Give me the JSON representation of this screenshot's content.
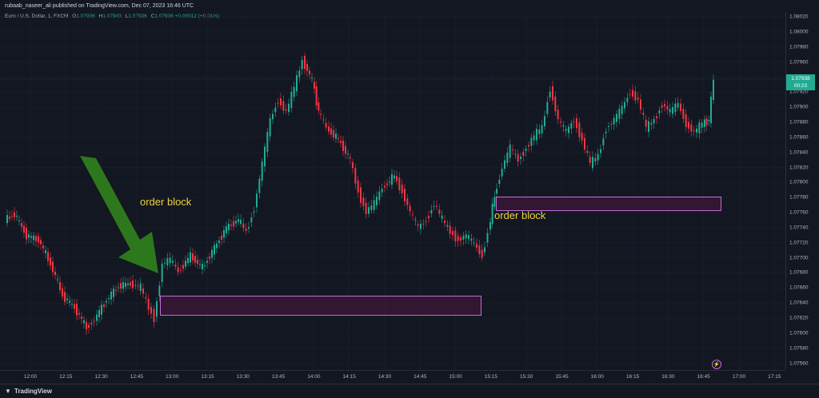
{
  "header": {
    "publisher_text": "rubaab_naseer_ali published on TradingView.com, Dec 07, 2023 16:46 UTC"
  },
  "symbol": {
    "name": "Euro / U.S. Dollar, 1, FXCM",
    "o_label": "O",
    "o_value": "1.07936",
    "h_label": "H",
    "h_value": "1.07943",
    "l_label": "L",
    "l_value": "1.07926",
    "c_label": "C",
    "c_value": "1.07938",
    "change": "+0.00012 (+0.01%)"
  },
  "price_scale": {
    "ticks": [
      "1.08020",
      "1.08000",
      "1.07980",
      "1.07960",
      "1.07940",
      "1.07920",
      "1.07900",
      "1.07880",
      "1.07860",
      "1.07840",
      "1.07820",
      "1.07800",
      "1.07780",
      "1.07760",
      "1.07740",
      "1.07720",
      "1.07700",
      "1.07680",
      "1.07660",
      "1.07640",
      "1.07620",
      "1.07600",
      "1.07580",
      "1.07560"
    ],
    "current_price": "1.07938",
    "countdown": "00:23"
  },
  "time_scale": {
    "ticks": [
      "12:00",
      "12:15",
      "12:30",
      "12:45",
      "13:00",
      "13:15",
      "13:30",
      "13:45",
      "14:00",
      "14:15",
      "14:30",
      "14:45",
      "15:00",
      "15:15",
      "15:30",
      "15:45",
      "16:00",
      "16:15",
      "16:30",
      "16:45",
      "17:00",
      "17:15"
    ]
  },
  "annotations": {
    "label_left": "order block",
    "label_right": "order block"
  },
  "footer": {
    "brand": "TradingView"
  },
  "colors": {
    "background": "#131722",
    "up": "#22ab94",
    "down": "#f23645",
    "annotation_text": "#f0d43a",
    "order_block_border": "#c06fd0",
    "arrow": "#2e7d1e"
  }
}
